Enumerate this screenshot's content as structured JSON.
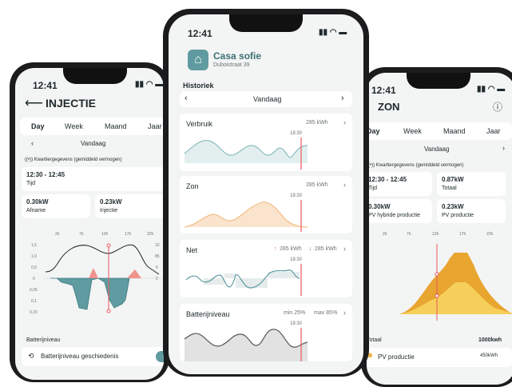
{
  "left": {
    "time": "12:41",
    "title": "INJECTIE",
    "tabs": [
      "Day",
      "Week",
      "Maand",
      "Jaar"
    ],
    "date": "Vandaag",
    "quarter_label": "Kwartiergegevens (gemiddeld vermogen)",
    "range_value": "12:30 - 12:45",
    "range_label": "Tijd",
    "afname_value": "0.30kW",
    "afname_label": "Afname",
    "injectie_value": "0.23kW",
    "injectie_label": "Injectie",
    "hours": [
      "2h",
      "7h",
      "12h",
      "17h",
      "22h"
    ],
    "left_ticks": [
      "1,5",
      "1,0",
      "0,5",
      "0",
      "0,05",
      "0,1",
      "0,15"
    ],
    "right_ticks": [
      "10",
      "85",
      "5",
      "0"
    ],
    "battery_section": "Batterijniveau",
    "battery_history": "Batterijniveau geschiedenis"
  },
  "center": {
    "time": "12:41",
    "home_name": "Casa sofie",
    "address": "Duboistraat 39",
    "section": "Historiek",
    "date": "Vandaag",
    "cards": [
      {
        "title": "Verbruik",
        "value": "285 kWh",
        "marker": "18:30"
      },
      {
        "title": "Zon",
        "value": "285 kWh",
        "marker": "18:30"
      },
      {
        "title": "Net",
        "up": "285 kWh",
        "down": "285 kWh",
        "marker": "18:30"
      },
      {
        "title": "Batterijniveau",
        "min": "min 25%",
        "max": "max 85%",
        "marker": "18:30"
      }
    ]
  },
  "right": {
    "time": "12:41",
    "title": "ZON",
    "tabs": [
      "Day",
      "Week",
      "Maand",
      "Jaar"
    ],
    "date": "Vandaag",
    "quarter_label": "Kwartiergegevens (gemiddeld vermogen)",
    "range_value": "12:30 - 12:45",
    "range_label": "Tijd",
    "total_value": "0.87kW",
    "total_label": "Totaal",
    "pvh_value": "0.30kW",
    "pvh_label": "PV hybride productie",
    "pv_value": "0.23kW",
    "pv_label": "PV productie",
    "hours": [
      "2h",
      "7h",
      "12h",
      "17h",
      "22h"
    ],
    "total_row_label": "Totaal",
    "total_row_value": "1000kwh",
    "pv_row_label": "PV productie",
    "pv_row_value": "450kWh"
  },
  "colors": {
    "teal": "#5f9ba0",
    "salmon": "#f0938d",
    "orange": "#f2b544",
    "accent": "#e8585e",
    "bg": "#f3f4f4"
  }
}
